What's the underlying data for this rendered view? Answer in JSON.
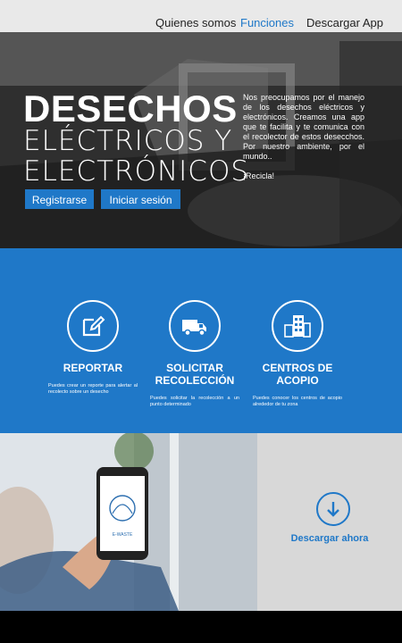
{
  "nav": {
    "items": [
      {
        "label": "Quienes somos"
      },
      {
        "label": "Funciones"
      },
      {
        "label": "Descargar App"
      }
    ]
  },
  "hero": {
    "title": "DESECHOS",
    "subtitle_1": "ELÉCTRICOS Y",
    "subtitle_2": "ELECTRÓNICOS",
    "register_label": "Registrarse",
    "login_label": "Iniciar sesión",
    "description": "Nos preocupamos por el manejo de los desechos eléctricos y electrónicos. Creamos una app que te facilita y te comunica con el recolector de estos desecchos. Por nuestro ambiente, por el mundo..",
    "cta_text": "¡Recicla!"
  },
  "features": [
    {
      "title": "REPORTAR",
      "text": "Puedes crear un reporte para alertar al recolecto sobre un desecho",
      "icon": "edit-icon"
    },
    {
      "title": "SOLICITAR RECOLECCIÓN",
      "text": "Puedes solicitar la recolección a un punto determinado",
      "icon": "truck-icon"
    },
    {
      "title": "CENTROS DE ACOPIO",
      "text": "Puedes conocer los centros de acopio alrededor de tu zona",
      "icon": "buildings-icon"
    }
  ],
  "download": {
    "label": "Descargar ahora",
    "app_name": "E-WASTE"
  },
  "colors": {
    "accent": "#1f78c8",
    "nav_bg": "#e9e9e9",
    "download_bg": "#d8d8d8"
  }
}
